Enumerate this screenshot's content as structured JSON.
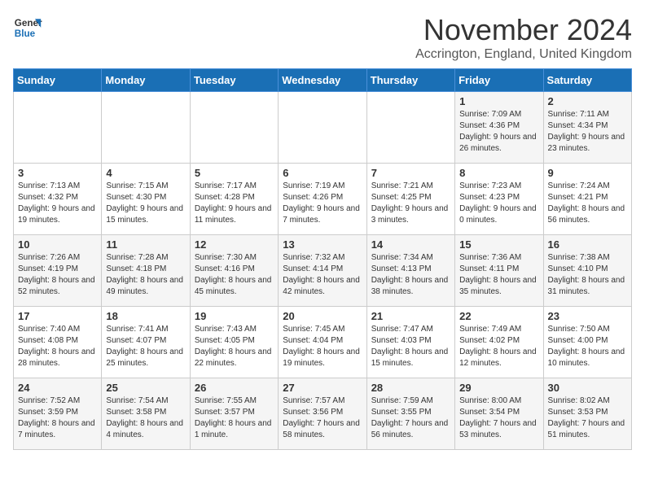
{
  "logo": {
    "line1": "General",
    "line2": "Blue"
  },
  "title": "November 2024",
  "subtitle": "Accrington, England, United Kingdom",
  "days_of_week": [
    "Sunday",
    "Monday",
    "Tuesday",
    "Wednesday",
    "Thursday",
    "Friday",
    "Saturday"
  ],
  "weeks": [
    [
      {
        "day": "",
        "info": ""
      },
      {
        "day": "",
        "info": ""
      },
      {
        "day": "",
        "info": ""
      },
      {
        "day": "",
        "info": ""
      },
      {
        "day": "",
        "info": ""
      },
      {
        "day": "1",
        "info": "Sunrise: 7:09 AM\nSunset: 4:36 PM\nDaylight: 9 hours and 26 minutes."
      },
      {
        "day": "2",
        "info": "Sunrise: 7:11 AM\nSunset: 4:34 PM\nDaylight: 9 hours and 23 minutes."
      }
    ],
    [
      {
        "day": "3",
        "info": "Sunrise: 7:13 AM\nSunset: 4:32 PM\nDaylight: 9 hours and 19 minutes."
      },
      {
        "day": "4",
        "info": "Sunrise: 7:15 AM\nSunset: 4:30 PM\nDaylight: 9 hours and 15 minutes."
      },
      {
        "day": "5",
        "info": "Sunrise: 7:17 AM\nSunset: 4:28 PM\nDaylight: 9 hours and 11 minutes."
      },
      {
        "day": "6",
        "info": "Sunrise: 7:19 AM\nSunset: 4:26 PM\nDaylight: 9 hours and 7 minutes."
      },
      {
        "day": "7",
        "info": "Sunrise: 7:21 AM\nSunset: 4:25 PM\nDaylight: 9 hours and 3 minutes."
      },
      {
        "day": "8",
        "info": "Sunrise: 7:23 AM\nSunset: 4:23 PM\nDaylight: 9 hours and 0 minutes."
      },
      {
        "day": "9",
        "info": "Sunrise: 7:24 AM\nSunset: 4:21 PM\nDaylight: 8 hours and 56 minutes."
      }
    ],
    [
      {
        "day": "10",
        "info": "Sunrise: 7:26 AM\nSunset: 4:19 PM\nDaylight: 8 hours and 52 minutes."
      },
      {
        "day": "11",
        "info": "Sunrise: 7:28 AM\nSunset: 4:18 PM\nDaylight: 8 hours and 49 minutes."
      },
      {
        "day": "12",
        "info": "Sunrise: 7:30 AM\nSunset: 4:16 PM\nDaylight: 8 hours and 45 minutes."
      },
      {
        "day": "13",
        "info": "Sunrise: 7:32 AM\nSunset: 4:14 PM\nDaylight: 8 hours and 42 minutes."
      },
      {
        "day": "14",
        "info": "Sunrise: 7:34 AM\nSunset: 4:13 PM\nDaylight: 8 hours and 38 minutes."
      },
      {
        "day": "15",
        "info": "Sunrise: 7:36 AM\nSunset: 4:11 PM\nDaylight: 8 hours and 35 minutes."
      },
      {
        "day": "16",
        "info": "Sunrise: 7:38 AM\nSunset: 4:10 PM\nDaylight: 8 hours and 31 minutes."
      }
    ],
    [
      {
        "day": "17",
        "info": "Sunrise: 7:40 AM\nSunset: 4:08 PM\nDaylight: 8 hours and 28 minutes."
      },
      {
        "day": "18",
        "info": "Sunrise: 7:41 AM\nSunset: 4:07 PM\nDaylight: 8 hours and 25 minutes."
      },
      {
        "day": "19",
        "info": "Sunrise: 7:43 AM\nSunset: 4:05 PM\nDaylight: 8 hours and 22 minutes."
      },
      {
        "day": "20",
        "info": "Sunrise: 7:45 AM\nSunset: 4:04 PM\nDaylight: 8 hours and 19 minutes."
      },
      {
        "day": "21",
        "info": "Sunrise: 7:47 AM\nSunset: 4:03 PM\nDaylight: 8 hours and 15 minutes."
      },
      {
        "day": "22",
        "info": "Sunrise: 7:49 AM\nSunset: 4:02 PM\nDaylight: 8 hours and 12 minutes."
      },
      {
        "day": "23",
        "info": "Sunrise: 7:50 AM\nSunset: 4:00 PM\nDaylight: 8 hours and 10 minutes."
      }
    ],
    [
      {
        "day": "24",
        "info": "Sunrise: 7:52 AM\nSunset: 3:59 PM\nDaylight: 8 hours and 7 minutes."
      },
      {
        "day": "25",
        "info": "Sunrise: 7:54 AM\nSunset: 3:58 PM\nDaylight: 8 hours and 4 minutes."
      },
      {
        "day": "26",
        "info": "Sunrise: 7:55 AM\nSunset: 3:57 PM\nDaylight: 8 hours and 1 minute."
      },
      {
        "day": "27",
        "info": "Sunrise: 7:57 AM\nSunset: 3:56 PM\nDaylight: 7 hours and 58 minutes."
      },
      {
        "day": "28",
        "info": "Sunrise: 7:59 AM\nSunset: 3:55 PM\nDaylight: 7 hours and 56 minutes."
      },
      {
        "day": "29",
        "info": "Sunrise: 8:00 AM\nSunset: 3:54 PM\nDaylight: 7 hours and 53 minutes."
      },
      {
        "day": "30",
        "info": "Sunrise: 8:02 AM\nSunset: 3:53 PM\nDaylight: 7 hours and 51 minutes."
      }
    ]
  ]
}
